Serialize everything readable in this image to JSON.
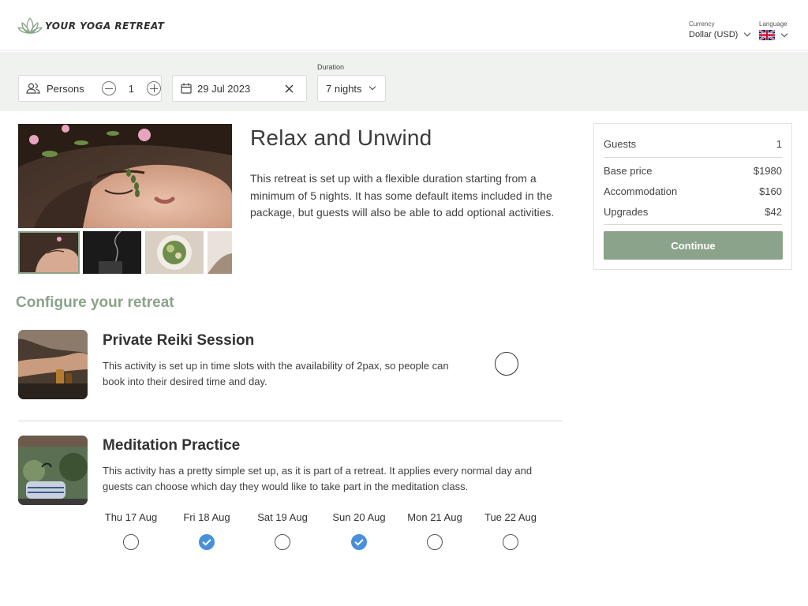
{
  "header": {
    "logo_text": "YOUR YOGA RETREAT",
    "currency_label": "Currency",
    "currency_value": "Dollar (USD)",
    "language_label": "Language"
  },
  "filters": {
    "persons_label": "Persons",
    "persons_count": "1",
    "date_value": "29 Jul 2023",
    "duration_label": "Duration",
    "duration_value": "7 nights"
  },
  "retreat": {
    "title": "Relax and Unwind",
    "description": "This retreat is set up with a flexible duration starting from a minimum of 5 nights. It has some default items included in the package, but guests will also be able to add optional activities."
  },
  "summary": {
    "guests_label": "Guests",
    "guests_value": "1",
    "base_price_label": "Base price",
    "base_price_value": "$1980",
    "accommodation_label": "Accommodation",
    "accommodation_value": "$160",
    "upgrades_label": "Upgrades",
    "upgrades_value": "$42",
    "continue_label": "Continue"
  },
  "configure": {
    "heading": "Configure your retreat",
    "activities": [
      {
        "title": "Private Reiki Session",
        "description": "This activity is set up in time slots with the availability of 2pax, so people can book into their desired time and day."
      },
      {
        "title": "Meditation Practice",
        "description": "This activity has a pretty simple set up, as it is part of a retreat. It applies every normal day and guests can choose which day they would like to take part in the meditation class."
      }
    ],
    "days": [
      {
        "label": "Thu 17 Aug",
        "selected": false
      },
      {
        "label": "Fri 18 Aug",
        "selected": true
      },
      {
        "label": "Sat 19 Aug",
        "selected": false
      },
      {
        "label": "Sun 20 Aug",
        "selected": true
      },
      {
        "label": "Mon 21 Aug",
        "selected": false
      },
      {
        "label": "Tue 22 Aug",
        "selected": false
      }
    ]
  },
  "colors": {
    "accent_green": "#8ba38a",
    "filter_bg": "#eff2ee",
    "check_blue": "#4a8fdb"
  },
  "icons": [
    "lotus-icon",
    "chevron-down-icon",
    "uk-flag-icon",
    "persons-icon",
    "minus-icon",
    "plus-icon",
    "calendar-icon",
    "close-icon",
    "check-icon"
  ]
}
